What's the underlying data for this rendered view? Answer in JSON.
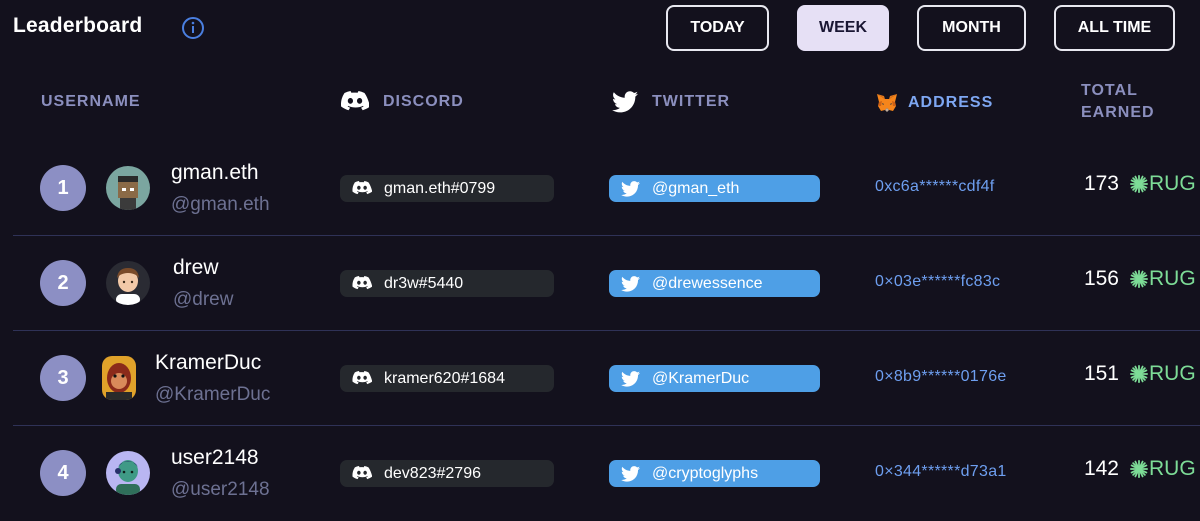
{
  "header": {
    "title": "Leaderboard",
    "ranges": [
      "TODAY",
      "WEEK",
      "MONTH",
      "ALL TIME"
    ],
    "active_range": "WEEK"
  },
  "columns": {
    "username": "USERNAME",
    "discord": "DISCORD",
    "twitter": "TWITTER",
    "address": "ADDRESS",
    "earned_line1": "TOTAL",
    "earned_line2": "EARNED"
  },
  "token": "RUG",
  "colors": {
    "background": "#13111d",
    "rank_badge": "#8c8fc4",
    "twitter_pill": "#4e9fe6",
    "discord_pill": "#25282d",
    "address": "#6e9ff0",
    "token": "#7ddc97",
    "active_tab": "#e6e0f5"
  },
  "rows": [
    {
      "rank": "1",
      "name": "gman.eth",
      "handle": "@gman.eth",
      "discord": "gman.eth#0799",
      "twitter": "@gman_eth",
      "address": "0xc6a******cdf4f",
      "earned": "173"
    },
    {
      "rank": "2",
      "name": "drew",
      "handle": "@drew",
      "discord": "dr3w#5440",
      "twitter": "@drewessence",
      "address": "0×03e******fc83c",
      "earned": "156"
    },
    {
      "rank": "3",
      "name": "KramerDuc",
      "handle": "@KramerDuc",
      "discord": "kramer620#1684",
      "twitter": "@KramerDuc",
      "address": "0×8b9******0176e",
      "earned": "151"
    },
    {
      "rank": "4",
      "name": "user2148",
      "handle": "@user2148",
      "discord": "dev823#2796",
      "twitter": "@cryptoglyphs",
      "address": "0×344******d73a1",
      "earned": "142"
    }
  ]
}
